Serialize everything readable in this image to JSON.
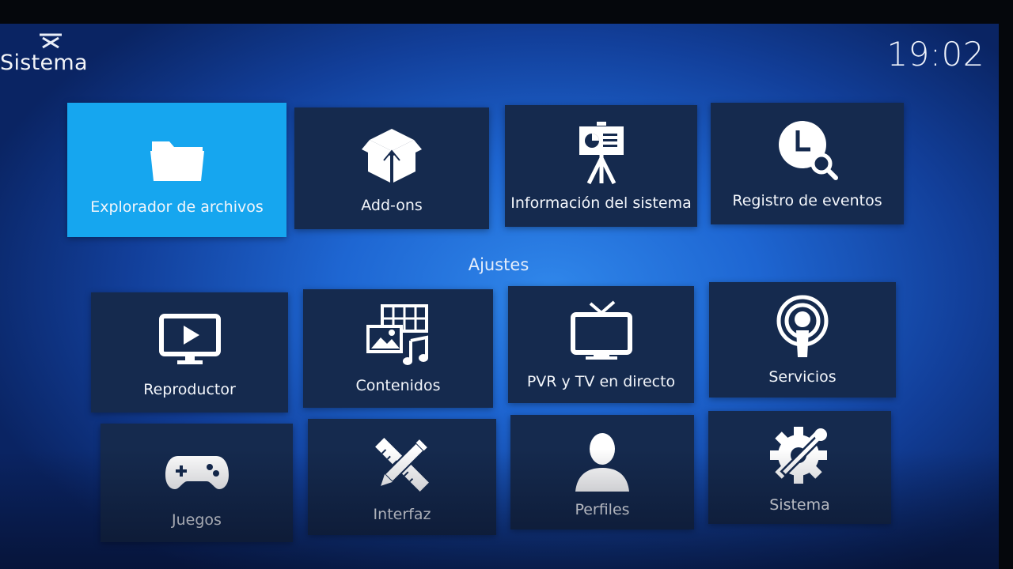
{
  "header": {
    "title": "Sistema",
    "clock": "19:02"
  },
  "top_row": [
    {
      "label": "Explorador de archivos",
      "icon": "folder-icon",
      "focused": true
    },
    {
      "label": "Add-ons",
      "icon": "box-icon"
    },
    {
      "label": "Información del sistema",
      "icon": "presentation-easel-icon"
    },
    {
      "label": "Registro de eventos",
      "icon": "clock-search-icon"
    }
  ],
  "section": {
    "heading": "Ajustes"
  },
  "settings": [
    {
      "label": "Reproductor",
      "icon": "monitor-play-icon"
    },
    {
      "label": "Contenidos",
      "icon": "media-library-icon"
    },
    {
      "label": "PVR y TV en directo",
      "icon": "tv-antenna-icon"
    },
    {
      "label": "Servicios",
      "icon": "broadcast-icon"
    },
    {
      "label": "Juegos",
      "icon": "gamepad-icon"
    },
    {
      "label": "Interfaz",
      "icon": "pencil-ruler-icon"
    },
    {
      "label": "Perfiles",
      "icon": "user-profile-icon"
    },
    {
      "label": "Sistema",
      "icon": "gear-wrench-icon"
    }
  ],
  "colors": {
    "tile": "#152a4e",
    "focused_tile": "#16a6ef",
    "background": "#1e66d2"
  }
}
